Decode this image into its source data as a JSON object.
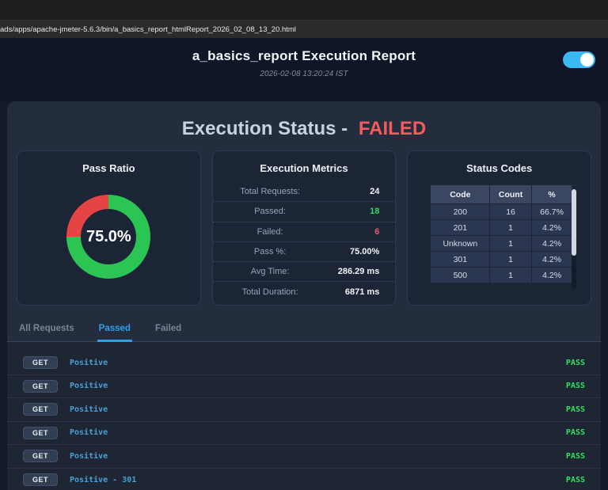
{
  "browser": {
    "url": "ads/apps/apache-jmeter-5.6.3/bin/a_basics_report_htmlReport_2026_02_08_13_20.html"
  },
  "header": {
    "title": "a_basics_report Execution Report",
    "timestamp": "2026-02-08 13:20:24 IST",
    "toggle_on": true
  },
  "status_banner": {
    "prefix": "Execution Status -",
    "status": "FAILED"
  },
  "cards": {
    "pass_ratio": {
      "title": "Pass Ratio",
      "center_label": "75.0%",
      "pass_percent": 75.0,
      "fail_percent": 25.0
    },
    "metrics": {
      "title": "Execution Metrics",
      "rows": [
        {
          "label": "Total Requests:",
          "value": "24",
          "tone": "normal"
        },
        {
          "label": "Passed:",
          "value": "18",
          "tone": "pass"
        },
        {
          "label": "Failed:",
          "value": "6",
          "tone": "fail"
        },
        {
          "label": "Pass %:",
          "value": "75.00%",
          "tone": "normal"
        },
        {
          "label": "Avg Time:",
          "value": "286.29 ms",
          "tone": "normal"
        },
        {
          "label": "Total Duration:",
          "value": "6871 ms",
          "tone": "normal"
        }
      ]
    },
    "status_codes": {
      "title": "Status Codes",
      "columns": [
        "Code",
        "Count",
        "%"
      ],
      "rows": [
        [
          "200",
          "16",
          "66.7%"
        ],
        [
          "201",
          "1",
          "4.2%"
        ],
        [
          "Unknown",
          "1",
          "4.2%"
        ],
        [
          "301",
          "1",
          "4.2%"
        ],
        [
          "500",
          "1",
          "4.2%"
        ]
      ]
    }
  },
  "tabs": [
    {
      "label": "All Requests",
      "active": false
    },
    {
      "label": "Passed",
      "active": true
    },
    {
      "label": "Failed",
      "active": false
    }
  ],
  "requests": [
    {
      "method": "GET",
      "name": "Positive",
      "result": "PASS"
    },
    {
      "method": "GET",
      "name": "Positive",
      "result": "PASS"
    },
    {
      "method": "GET",
      "name": "Positive",
      "result": "PASS"
    },
    {
      "method": "GET",
      "name": "Positive",
      "result": "PASS"
    },
    {
      "method": "GET",
      "name": "Positive",
      "result": "PASS"
    },
    {
      "method": "GET",
      "name": "Positive - 301",
      "result": "PASS"
    }
  ],
  "colors": {
    "accent_blue": "#2f9fe8",
    "toggle_blue": "#3cb9f2",
    "pass_green": "#2bc553",
    "fail_red": "#e64444",
    "link_blue": "#4b9fd9",
    "result_green": "#32e060",
    "failed_text": "#f25c5c"
  },
  "chart_data": {
    "type": "pie",
    "title": "Pass Ratio",
    "labels": [
      "Passed",
      "Failed"
    ],
    "values": [
      75.0,
      25.0
    ],
    "colors": [
      "#2bc553",
      "#e64444"
    ],
    "center_label": "75.0%"
  }
}
